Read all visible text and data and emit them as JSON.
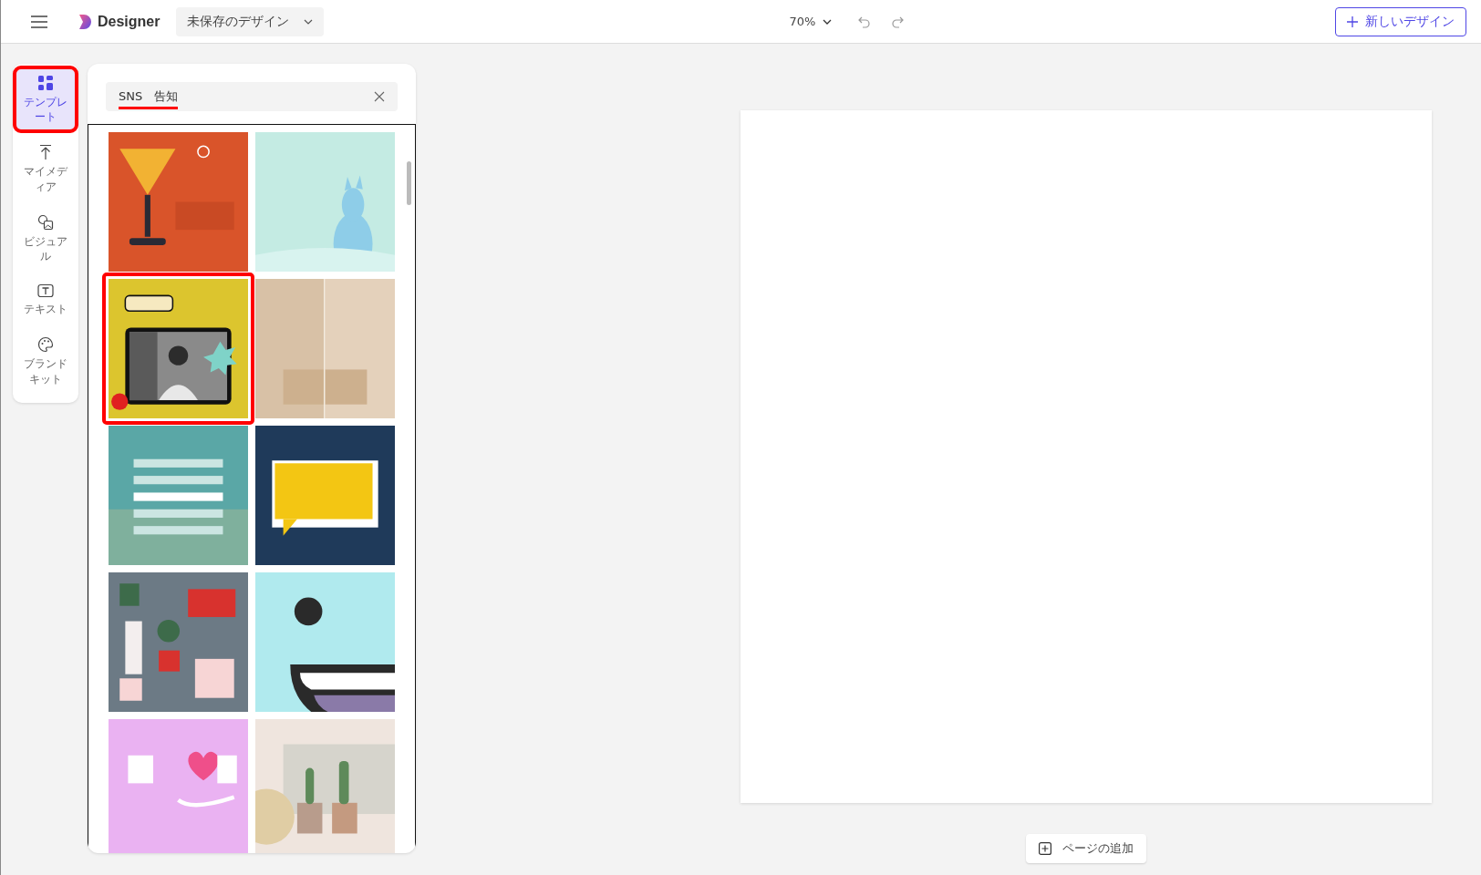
{
  "top_bar": {
    "app_name": "Designer",
    "document_title": "未保存のデザイン",
    "zoom": "70%",
    "new_design_button": "新しいデザイン"
  },
  "sidebar": {
    "items": [
      {
        "kind": "templates",
        "label": "テンプレート",
        "selected": true,
        "highlighted": true
      },
      {
        "kind": "upload",
        "label": "マイメディア",
        "selected": false,
        "highlighted": false
      },
      {
        "kind": "visuals",
        "label": "ビジュアル",
        "selected": false,
        "highlighted": false
      },
      {
        "kind": "text",
        "label": "テキスト",
        "selected": false,
        "highlighted": false
      },
      {
        "kind": "brand",
        "label": "ブランドキット",
        "selected": false,
        "highlighted": false
      }
    ]
  },
  "search": {
    "value": "SNS　告知",
    "underlined": true
  },
  "templates": [
    {
      "kind": "picture"
    },
    {
      "kind": "picture"
    },
    {
      "kind": "picture",
      "highlighted": true
    },
    {
      "kind": "picture"
    },
    {
      "kind": "picture"
    },
    {
      "kind": "picture"
    },
    {
      "kind": "picture"
    },
    {
      "kind": "picture"
    },
    {
      "kind": "picture"
    },
    {
      "kind": "picture"
    }
  ],
  "add_page_button": "ページの追加"
}
